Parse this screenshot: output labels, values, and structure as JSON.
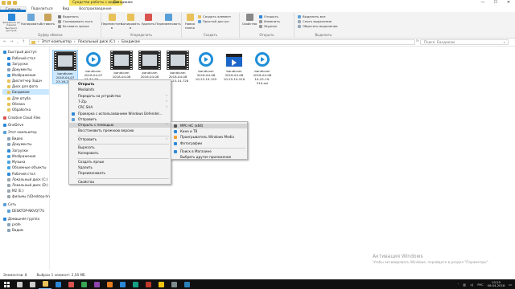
{
  "window": {
    "title": "Бандикам",
    "tools_context": "Средства работы с видео",
    "controls": {
      "minimize": "—",
      "maximize": "☐",
      "close": "✕"
    }
  },
  "tabs": [
    "Файл",
    "Главная",
    "Поделиться",
    "Вид",
    "Воспроизведение"
  ],
  "ribbon": {
    "groups": {
      "clipboard": "Буфер обмена",
      "organize": "Упорядочить",
      "new": "Создать",
      "open": "Открыть",
      "select": "Выделить"
    },
    "buttons": {
      "pin": "Закрепить на панели быстрого доступа",
      "copy": "Копировать",
      "paste": "Вставить",
      "cut": "Вырезать",
      "copy_path": "Скопировать путь",
      "paste_shortcut": "Вставить ярлык",
      "move_to": "Переместить в",
      "copy_to": "Копировать в",
      "delete": "Удалить",
      "rename": "Переименовать",
      "new_folder": "Новая папка",
      "new_item": "Создать элемент",
      "easy_access": "Простой доступ",
      "properties": "Свойства",
      "open": "Открыть",
      "edit": "Изменить",
      "history": "Журнал",
      "select_all": "Выделить все",
      "select_none": "Снять выделение",
      "invert": "Обратить выделение"
    }
  },
  "address": {
    "crumbs": [
      "Этот компьютер",
      "Локальный диск (C:)",
      "Бандикам"
    ],
    "search_placeholder": "Поиск: Бандикам"
  },
  "nav": [
    {
      "label": "Быстрый доступ",
      "icon": "star-icon",
      "color": "#2b88d8",
      "indent": 0
    },
    {
      "label": "Рабочий стол",
      "icon": "desktop-icon",
      "color": "#2b88d8",
      "indent": 1
    },
    {
      "label": "Загрузки",
      "icon": "download-icon",
      "color": "#2b88d8",
      "indent": 1
    },
    {
      "label": "Документы",
      "icon": "documents-icon",
      "color": "#8aa3b8",
      "indent": 1
    },
    {
      "label": "Изображения",
      "icon": "pictures-icon",
      "color": "#4aa3df",
      "indent": 1
    },
    {
      "label": "Диспетчер Задач",
      "icon": "folder-icon",
      "color": "#e8c15a",
      "indent": 1
    },
    {
      "label": "Диск для фото",
      "icon": "folder-icon",
      "color": "#e8c15a",
      "indent": 1
    },
    {
      "label": "Бандикам",
      "icon": "folder-icon",
      "color": "#e8c15a",
      "indent": 1,
      "selected": true
    },
    {
      "label": "Для ютуба",
      "icon": "folder-icon",
      "color": "#e8c15a",
      "indent": 1
    },
    {
      "label": "Облака",
      "icon": "folder-icon",
      "color": "#e8c15a",
      "indent": 1
    },
    {
      "label": "Обработка",
      "icon": "folder-icon",
      "color": "#e8c15a",
      "indent": 1
    },
    {
      "label": "Creative Cloud Files",
      "icon": "creative-cloud-icon",
      "color": "#d9534f",
      "indent": 0
    },
    {
      "label": "OneDrive",
      "icon": "onedrive-icon",
      "color": "#2b88d8",
      "indent": 0
    },
    {
      "label": "Этот компьютер",
      "icon": "computer-icon",
      "color": "#5aa0d8",
      "indent": 0
    },
    {
      "label": "Видео",
      "icon": "video-folder-icon",
      "color": "#8aa3b8",
      "indent": 1
    },
    {
      "label": "Документы",
      "icon": "documents-icon",
      "color": "#8aa3b8",
      "indent": 1
    },
    {
      "label": "Загрузки",
      "icon": "download-icon",
      "color": "#2b88d8",
      "indent": 1
    },
    {
      "label": "Изображения",
      "icon": "pictures-icon",
      "color": "#4aa3df",
      "indent": 1
    },
    {
      "label": "Музыка",
      "icon": "music-icon",
      "color": "#4aa3df",
      "indent": 1
    },
    {
      "label": "Объемные объекты",
      "icon": "3d-objects-icon",
      "color": "#4aa3df",
      "indent": 1
    },
    {
      "label": "Рабочий стол",
      "icon": "desktop-icon",
      "color": "#2b88d8",
      "indent": 1
    },
    {
      "label": "Локальный диск (C:)",
      "icon": "drive-icon",
      "color": "#9aa6ae",
      "indent": 1
    },
    {
      "label": "Локальный диск (D:)",
      "icon": "drive-icon",
      "color": "#9aa6ae",
      "indent": 1
    },
    {
      "label": "M2 (E:)",
      "icon": "drive-icon",
      "color": "#9aa6ae",
      "indent": 1
    },
    {
      "label": "фильмы (\\\\Desktop-hn",
      "icon": "network-drive-icon",
      "color": "#9aa6ae",
      "indent": 1
    },
    {
      "label": "Сеть",
      "icon": "network-icon",
      "color": "#5aa0d8",
      "indent": 0
    },
    {
      "label": "DESKTOP-NKVQ77U",
      "icon": "computer-icon",
      "color": "#5aa0d8",
      "indent": 1
    },
    {
      "label": "Домашняя группа",
      "icon": "homegroup-icon",
      "color": "#2b88d8",
      "indent": 0
    },
    {
      "label": "profe",
      "icon": "user-icon",
      "color": "#8aa3b8",
      "indent": 1
    },
    {
      "label": "Вадим",
      "icon": "user-icon",
      "color": "#8aa3b8",
      "indent": 1
    }
  ],
  "files": [
    {
      "name": "bandicam",
      "date": "2018-04-07",
      "time": "23-16-20-...",
      "kind": "video",
      "selected": true
    },
    {
      "name": "bandicam",
      "date": "2018-04-07",
      "time": "23-32-55-...",
      "kind": "disc"
    },
    {
      "name": "bandicam",
      "date": "2018-04-08",
      "time": "00-...",
      "kind": "video"
    },
    {
      "name": "bandicam",
      "date": "2018-04-08",
      "time": "10-23-14-729",
      "kind": "video"
    },
    {
      "name": "bandicam",
      "date": "2018-04-08",
      "time": "10-23-14-728",
      "kind": "video"
    },
    {
      "name": "bandicam",
      "date": "2018-04-08",
      "time": "10-25-19-155",
      "kind": "disc"
    },
    {
      "name": "bandicam",
      "date": "2018-04-08",
      "time": "10-25-19-510",
      "kind": "clapper"
    },
    {
      "name": "bandicam",
      "date": "2018-04-08",
      "time": "10-25-19-510.avi",
      "kind": "disc"
    }
  ],
  "context_menu": [
    {
      "label": "Открыть",
      "bold": true
    },
    {
      "label": "MediaInfo"
    },
    {
      "label": "Передать на устройство",
      "submenu": true
    },
    {
      "label": "7-Zip",
      "submenu": true
    },
    {
      "label": "CRC SHA",
      "submenu": true
    },
    {
      "label": "Проверка с использованием Windows Defender...",
      "icon": "defender-icon",
      "color": "#2b88d8"
    },
    {
      "label": "Отправить",
      "icon": "share-icon",
      "color": "#5aa0d8"
    },
    {
      "label": "Открыть с помощью",
      "submenu": true,
      "highlighted": true
    },
    {
      "label": "Восстановить прежнюю версию"
    },
    {
      "label": "Отправить",
      "submenu": true,
      "separator_before": true
    },
    {
      "label": "Вырезать",
      "separator_before": true
    },
    {
      "label": "Копировать"
    },
    {
      "label": "Создать ярлык",
      "separator_before": true
    },
    {
      "label": "Удалить"
    },
    {
      "label": "Переименовать"
    },
    {
      "label": "Свойства",
      "separator_before": true
    }
  ],
  "open_with": [
    {
      "label": "MPC-HC (x64)",
      "icon": "mpc-icon",
      "color": "#555555",
      "highlighted": true
    },
    {
      "label": "Кино и ТВ",
      "icon": "movies-icon",
      "color": "#2b88d8"
    },
    {
      "label": "Проигрыватель Windows Media",
      "icon": "wmp-icon",
      "color": "#f0a030"
    },
    {
      "label": "Фотографии",
      "icon": "photos-icon",
      "color": "#2b88d8"
    },
    {
      "label": "Поиск в Магазине",
      "icon": "store-icon",
      "color": "#2b88d8",
      "separator_before": true
    },
    {
      "label": "Выбрать другое приложение"
    }
  ],
  "status": {
    "count": "Элементов: 8",
    "selection": "Выбран 1 элемент: 2,50 МБ"
  },
  "activation": {
    "line1": "Активация Windows",
    "line2": "Чтобы активировать Windows, перейдите в раздел \"Параметры\"."
  },
  "taskbar": {
    "apps": [
      {
        "name": "search-icon",
        "color": "#cccccc"
      },
      {
        "name": "task-view-icon",
        "color": "#cccccc"
      },
      {
        "name": "explorer-icon",
        "color": "#e8c15a",
        "open": true
      },
      {
        "name": "browser-icon",
        "color": "#2b88d8"
      },
      {
        "name": "app-icon",
        "color": "#d9534f"
      },
      {
        "name": "app-icon",
        "color": "#3aa655"
      },
      {
        "name": "app-icon",
        "color": "#8e44ad"
      },
      {
        "name": "app-icon",
        "color": "#e67e22"
      },
      {
        "name": "app-icon",
        "color": "#2b88d8"
      },
      {
        "name": "app-icon",
        "color": "#16a085"
      },
      {
        "name": "app-icon",
        "color": "#c0392b"
      },
      {
        "name": "app-icon",
        "color": "#f1c40f"
      },
      {
        "name": "app-icon",
        "color": "#7f8c8d"
      },
      {
        "name": "app-icon",
        "color": "#2980b9"
      }
    ],
    "time": "10:25",
    "date": "08.04.2018",
    "lang": "РУС"
  }
}
